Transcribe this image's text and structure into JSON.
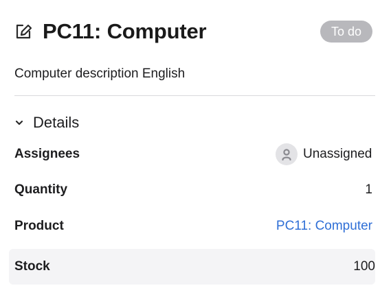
{
  "header": {
    "icon": "edit-square-icon",
    "title": "PC11: Computer",
    "status": "To do",
    "status_color": "#b8b8bc"
  },
  "description": "Computer description English",
  "details": {
    "section_title": "Details",
    "toggle_icon": "chevron-down-icon",
    "expanded": true,
    "rows": {
      "assignees": {
        "label": "Assignees",
        "value": "Unassigned",
        "icon": "user-icon"
      },
      "quantity": {
        "label": "Quantity",
        "value": "1"
      },
      "product": {
        "label": "Product",
        "value": "PC11: Computer",
        "link_color": "#2f6fd6"
      },
      "stock": {
        "label": "Stock",
        "value": "100"
      }
    }
  }
}
